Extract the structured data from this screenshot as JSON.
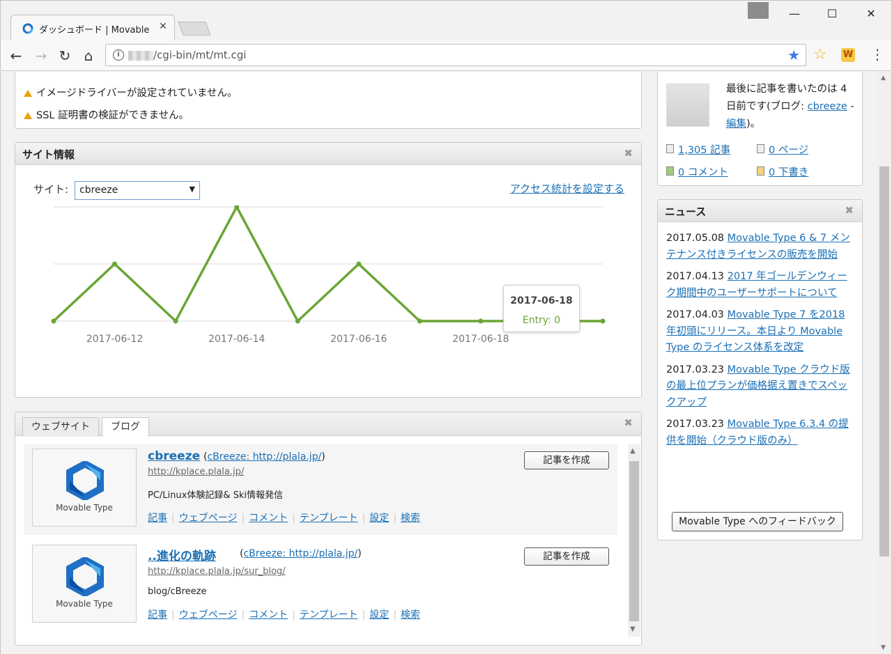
{
  "browser": {
    "tab_title": "ダッシュボード | Movable Type",
    "url": "/cgi-bin/mt/mt.cgi"
  },
  "warnings": [
    "イメージドライバーが設定されていません。",
    "SSL 証明書の検証ができません。"
  ],
  "site_info": {
    "title": "サイト情報",
    "site_label": "サイト:",
    "site_value": "cbreeze",
    "access_link": "アクセス統計を設定する",
    "tooltip": {
      "date": "2017-06-18",
      "value": "Entry: 0"
    }
  },
  "chart_data": {
    "type": "line",
    "x": [
      "2017-06-11",
      "2017-06-12",
      "2017-06-13",
      "2017-06-14",
      "2017-06-15",
      "2017-06-16",
      "2017-06-17",
      "2017-06-18",
      "2017-06-19",
      "2017-06-20"
    ],
    "tick_labels": [
      "2017-06-12",
      "2017-06-14",
      "2017-06-16",
      "2017-06-18"
    ],
    "series": [
      {
        "values": [
          0,
          1,
          0,
          2,
          0,
          1,
          0,
          0,
          0,
          0
        ],
        "color": "#6aa535"
      }
    ],
    "ylim": [
      0,
      2
    ],
    "grid": true,
    "highlight_index": 8
  },
  "blogs_panel": {
    "tabs": [
      "ウェブサイト",
      "ブログ"
    ],
    "active_tab": "ブログ",
    "blogs": [
      {
        "name": "cbreeze",
        "parent": "cBreeze: http://plala.jp/",
        "url": "http://kplace.plala.jp/",
        "description": "PC/Linux体験記録& Ski情報発信",
        "logo_text": "Movable Type",
        "create_label": "記事を作成",
        "links": [
          "記事",
          "ウェブページ",
          "コメント",
          "テンプレート",
          "設定",
          "検索"
        ]
      },
      {
        "name": "..進化の軌跡",
        "parent": "cBreeze: http://plala.jp/",
        "url": "http://kplace.plala.jp/sur_blog/",
        "description": "blog/cBreeze",
        "logo_text": "Movable Type",
        "create_label": "記事を作成",
        "links": [
          "記事",
          "ウェブページ",
          "コメント",
          "テンプレート",
          "設定",
          "検索"
        ]
      }
    ]
  },
  "user_panel": {
    "text_before": "最後に記事を書いたのは 4 日前です(ブログ: ",
    "blog_link": "cbreeze",
    "dash": " - ",
    "edit_link": "編集",
    "text_after": ")。",
    "stats": {
      "entries": "1,305 記事",
      "pages": "0 ページ",
      "comments": "0 コメント",
      "drafts": "0 下書き"
    }
  },
  "news": {
    "title": "ニュース",
    "items": [
      {
        "date": "2017.05.08",
        "text": "Movable Type 6 & 7 メンテナンス付きライセンスの販売を開始"
      },
      {
        "date": "2017.04.13",
        "text": "2017 年ゴールデンウィーク期間中のユーザーサポートについて"
      },
      {
        "date": "2017.04.03",
        "text": "Movable Type 7 を2018 年初頭にリリース。本日より Movable Type のライセンス体系を改定"
      },
      {
        "date": "2017.03.23",
        "text": "Movable Type クラウド版の最上位プランが価格据え置きでスペックアップ"
      },
      {
        "date": "2017.03.23",
        "text": "Movable Type 6.3.4 の提供を開始（クラウド版のみ）"
      }
    ],
    "feedback_label": "Movable Type へのフィードバック"
  }
}
